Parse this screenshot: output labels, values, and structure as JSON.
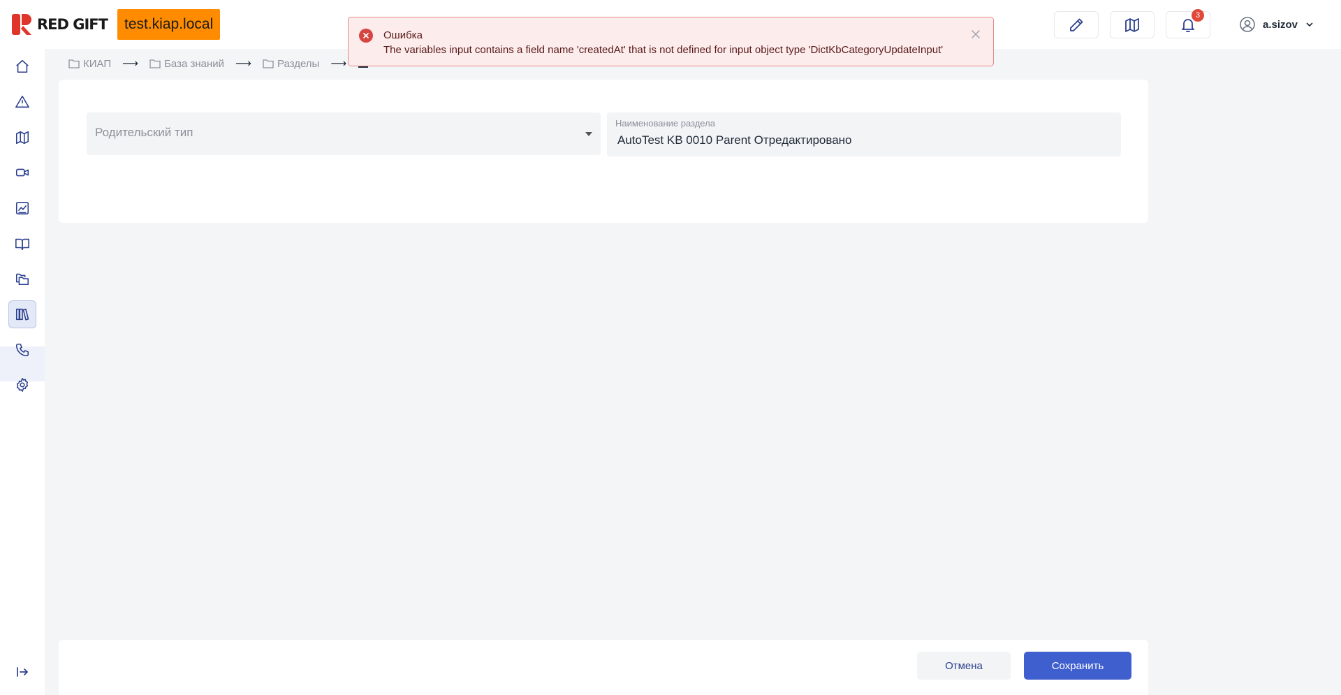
{
  "header": {
    "logo_text": "RED GIFT",
    "env": "test.kiap.local",
    "notifications_count": "3",
    "username": "a.sizov"
  },
  "sidebar": {
    "items": [
      {
        "icon": "home-icon"
      },
      {
        "icon": "alert-triangle-icon"
      },
      {
        "icon": "map-icon"
      },
      {
        "icon": "video-icon"
      },
      {
        "icon": "chart-icon"
      },
      {
        "icon": "book-open-icon"
      },
      {
        "icon": "folders-icon"
      },
      {
        "icon": "library-icon",
        "active": true
      },
      {
        "icon": "phone-icon"
      },
      {
        "icon": "gear-icon"
      }
    ],
    "collapse_icon": "expand-sidebar-icon"
  },
  "breadcrumb": {
    "items": [
      "КИАП",
      "База знаний",
      "Разделы"
    ],
    "current_icon": "folder-filled-icon"
  },
  "form": {
    "parent_type_placeholder": "Родительский тип",
    "section_name_label": "Наименование раздела",
    "section_name_value": "AutoTest KB 0010 Parent Отредактировано"
  },
  "footer": {
    "cancel_label": "Отмена",
    "save_label": "Сохранить"
  },
  "toast": {
    "title": "Ошибка",
    "message": "The variables input contains a field name 'createdAt' that is not defined for input object type 'DictKbCategoryUpdateInput'"
  },
  "colors": {
    "accent": "#3f5fcf",
    "env_badge": "#ff8c00",
    "brand_red": "#e0352b",
    "error": "#d64541",
    "error_bg": "#fcecec"
  }
}
